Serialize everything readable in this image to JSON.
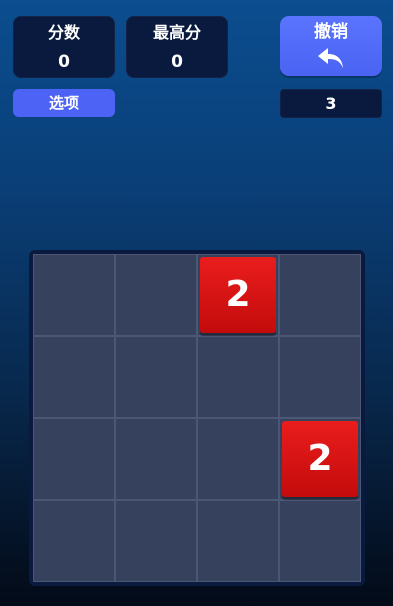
{
  "score": {
    "label": "分数",
    "value": "0"
  },
  "best": {
    "label": "最高分",
    "value": "0"
  },
  "undo": {
    "label": "撤销",
    "icon": "undo-arrow-icon",
    "remaining": "3"
  },
  "options": {
    "label": "选项"
  },
  "board": {
    "size": 4,
    "tiles": [
      {
        "row": 0,
        "col": 2,
        "value": "2"
      },
      {
        "row": 2,
        "col": 3,
        "value": "2"
      }
    ]
  },
  "colors": {
    "accent": "#4d63f5",
    "panel": "#0a1a3f",
    "tile_2": "#d91414",
    "grid": "#36415e"
  }
}
